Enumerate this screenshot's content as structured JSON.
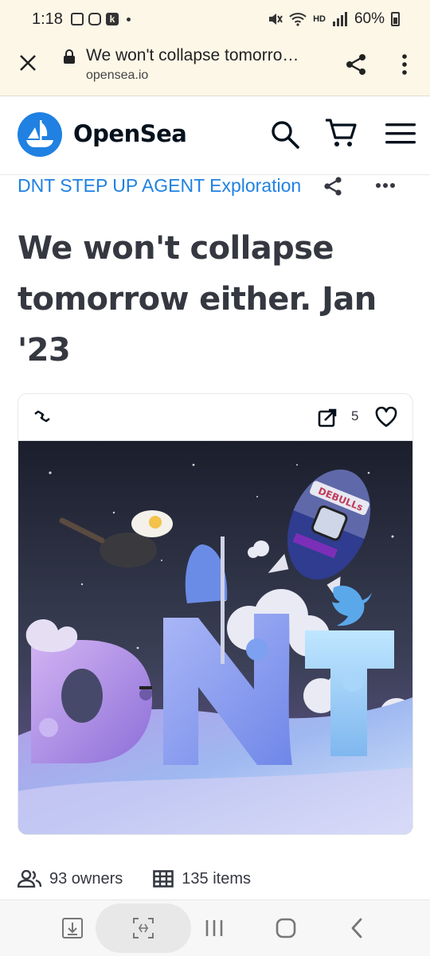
{
  "status_bar": {
    "time": "1:18",
    "battery": "60%",
    "hd_label": "HD"
  },
  "browser": {
    "page_title": "We won't collapse tomorro…",
    "host": "opensea.io"
  },
  "header": {
    "brand": "OpenSea"
  },
  "item": {
    "collection": "DNT STEP UP AGENT Exploration",
    "title": "We won't collapse tomorrow either. Jan '23",
    "favorites": "5",
    "artwork_text": "DEBULLs"
  },
  "stats": {
    "owners": "93 owners",
    "items": "135 items"
  },
  "colors": {
    "accent": "#2081e2",
    "text": "#353840",
    "browser_bar": "#fdf7e8"
  },
  "icons": [
    "close-icon",
    "lock-icon",
    "share-icon",
    "more-vert-icon",
    "search-icon",
    "cart-icon",
    "menu-icon",
    "more-horiz-icon",
    "chain-icon",
    "external-link-icon",
    "heart-icon",
    "people-icon",
    "grid-icon"
  ]
}
